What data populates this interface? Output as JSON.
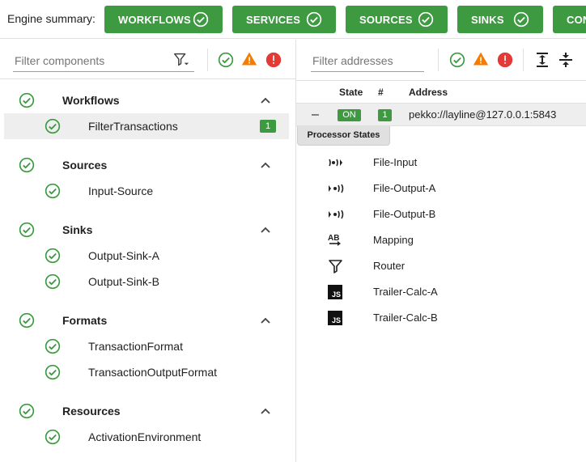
{
  "summary": {
    "label": "Engine summary:",
    "buttons": [
      {
        "label": "WORKFLOWS",
        "status": "ok"
      },
      {
        "label": "SERVICES",
        "status": "ok"
      },
      {
        "label": "SOURCES",
        "status": "ok"
      },
      {
        "label": "SINKS",
        "status": "ok"
      },
      {
        "label": "CON",
        "status": "ok"
      }
    ]
  },
  "left": {
    "filter_placeholder": "Filter components",
    "status_filters": [
      "ok-icon",
      "warning-icon",
      "error-icon"
    ],
    "groups": [
      {
        "name": "Workflows",
        "items": [
          {
            "name": "FilterTransactions",
            "count": "1",
            "selected": true
          }
        ]
      },
      {
        "name": "Sources",
        "items": [
          {
            "name": "Input-Source"
          }
        ]
      },
      {
        "name": "Sinks",
        "items": [
          {
            "name": "Output-Sink-A"
          },
          {
            "name": "Output-Sink-B"
          }
        ]
      },
      {
        "name": "Formats",
        "items": [
          {
            "name": "TransactionFormat"
          },
          {
            "name": "TransactionOutputFormat"
          }
        ]
      },
      {
        "name": "Resources",
        "items": [
          {
            "name": "ActivationEnvironment"
          }
        ]
      }
    ]
  },
  "right": {
    "filter_placeholder": "Filter addresses",
    "columns": {
      "state": "State",
      "count": "#",
      "address": "Address"
    },
    "node": {
      "collapse": "–",
      "state": "ON",
      "count": "1",
      "address": "pekko://layline@127.0.0.1:5843"
    },
    "processor_tab": "Processor States",
    "processors": [
      {
        "icon": "stream-input-icon",
        "name": "File-Input"
      },
      {
        "icon": "stream-output-icon",
        "name": "File-Output-A"
      },
      {
        "icon": "stream-output-icon",
        "name": "File-Output-B"
      },
      {
        "icon": "mapping-icon",
        "name": "Mapping"
      },
      {
        "icon": "filter-icon",
        "name": "Router"
      },
      {
        "icon": "javascript-icon",
        "name": "Trailer-Calc-A"
      },
      {
        "icon": "javascript-icon",
        "name": "Trailer-Calc-B"
      }
    ]
  },
  "colors": {
    "ok": "#3d9a41",
    "warning": "#f57c00",
    "error": "#e53935",
    "text": "#212121"
  }
}
